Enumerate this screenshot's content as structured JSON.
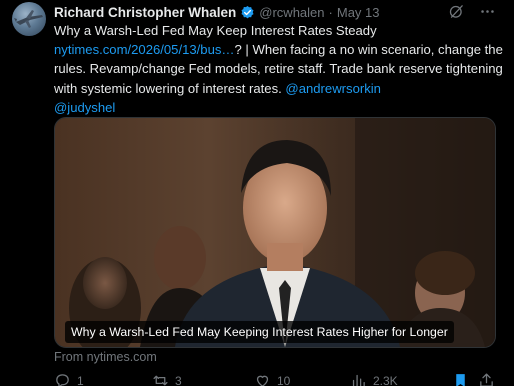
{
  "author": {
    "display_name": "Richard Christopher Whalen",
    "handle": "@rcwhalen",
    "separator": "·",
    "date": "May 13"
  },
  "tweet": {
    "line1": "Why a Warsh-Led Fed May Keep Interest Rates Steady",
    "link": "nytimes.com/2026/05/13/bus…",
    "after_link": "? | When facing a no win scenario, change the rules. Revamp/change Fed models, retire staff. Trade bank reserve tightening with systemic lowering of interest rates.",
    "mention1": "@andrewrsorkin",
    "mention2": "@judyshel"
  },
  "card": {
    "caption": "Why a Warsh-Led Fed May Keeping Interest Rates Higher for Longer",
    "source": "From nytimes.com"
  },
  "actions": {
    "reply_count": "1",
    "retweet_count": "3",
    "like_count": "10",
    "views_count": "2.3K"
  },
  "colors": {
    "accent": "#1d9bf0",
    "text": "#e7e9ea",
    "muted": "#71767b",
    "background": "#000000"
  },
  "icons": [
    "verified-badge-icon",
    "grok-icon",
    "more-icon",
    "reply-icon",
    "retweet-icon",
    "like-icon",
    "views-icon",
    "bookmark-icon",
    "share-icon"
  ]
}
